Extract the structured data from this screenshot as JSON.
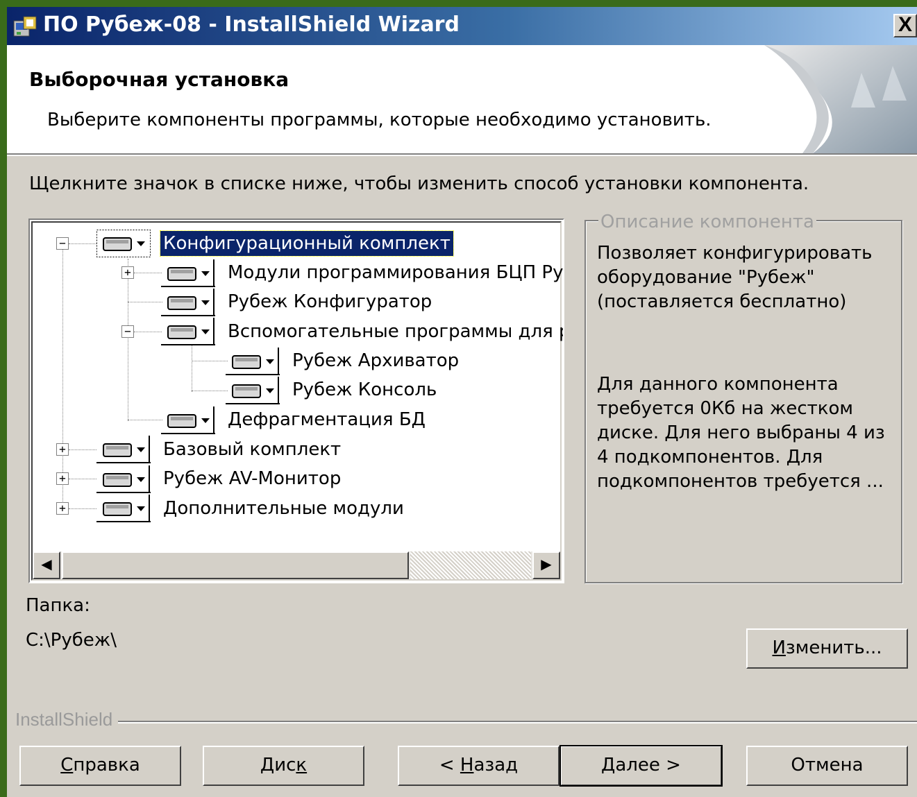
{
  "window": {
    "title": "ПО Рубеж-08 - InstallShield Wizard",
    "close_label": "X"
  },
  "header": {
    "title": "Выборочная установка",
    "subtitle": "Выберите компоненты программы, которые необходимо установить."
  },
  "instruction": "Щелкните значок в списке ниже, чтобы изменить способ установки компонента.",
  "tree": {
    "items": [
      {
        "label": "Конфигурационный комплект",
        "expander": "−"
      },
      {
        "label": "Модули программирования БЦП Руб",
        "expander": "+"
      },
      {
        "label": "Рубеж Конфигуратор",
        "expander": ""
      },
      {
        "label": "Вспомогательные программы для р.",
        "expander": "−"
      },
      {
        "label": "Рубеж Архиватор",
        "expander": ""
      },
      {
        "label": "Рубеж Консоль",
        "expander": ""
      },
      {
        "label": "Дефрагментация БД",
        "expander": ""
      },
      {
        "label": "Базовый комплект",
        "expander": "+"
      },
      {
        "label": "Рубеж AV-Монитор",
        "expander": "+"
      },
      {
        "label": "Дополнительные модули",
        "expander": "+"
      }
    ],
    "selected_index": 0
  },
  "description": {
    "legend": "Описание компонента",
    "text": "Позволяет конфигурировать оборудование \"Рубеж\" (поставляется бесплатно)",
    "size_text": "Для данного компонента требуется 0Кб на жестком диске. Для него выбраны 4 из 4 подкомпонентов. Для подкомпонентов требуется ..."
  },
  "folder": {
    "label": "Папка:",
    "path": "C:\\Рубеж\\",
    "change_button": {
      "pre": "",
      "accel": "И",
      "post": "зменить..."
    }
  },
  "brand": "InstallShield",
  "buttons": {
    "help": {
      "pre": "",
      "accel": "С",
      "post": "правка"
    },
    "disk": {
      "pre": "Дис",
      "accel": "к",
      "post": ""
    },
    "back": {
      "pre": "< ",
      "accel": "Н",
      "post": "азад"
    },
    "next": {
      "pre": "",
      "accel": "Д",
      "post": "алее >"
    },
    "cancel": {
      "pre": "Отмена",
      "accel": "",
      "post": ""
    }
  },
  "colors": {
    "background": "#3a6b1a",
    "dialog": "#d4d0c8",
    "title_gradient_start": "#0a246a",
    "title_gradient_end": "#a6caf0",
    "selection": "#0a246a"
  }
}
